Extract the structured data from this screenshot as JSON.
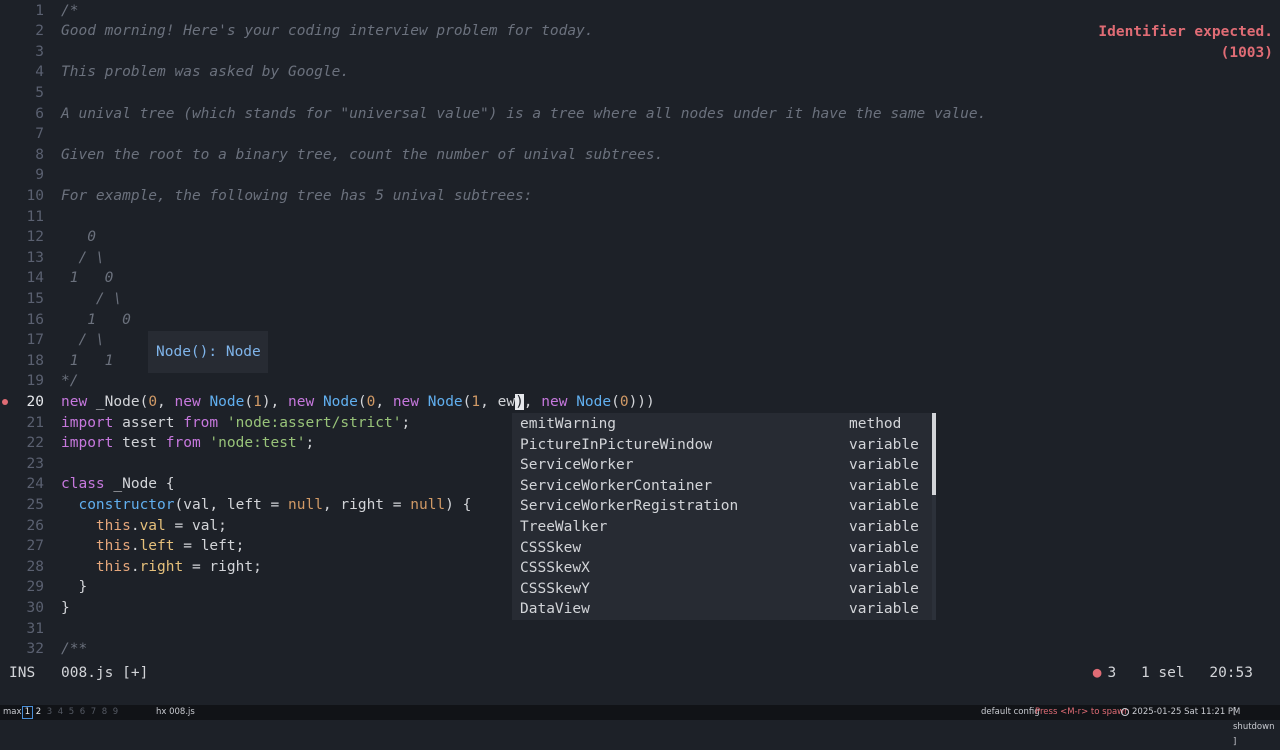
{
  "editor": {
    "lines": [
      {
        "n": "1",
        "parts": [
          {
            "t": "/*",
            "c": "comment"
          }
        ]
      },
      {
        "n": "2",
        "parts": [
          {
            "t": "Good morning! Here's your coding interview problem for today.",
            "c": "comment"
          }
        ]
      },
      {
        "n": "3",
        "parts": []
      },
      {
        "n": "4",
        "parts": [
          {
            "t": "This problem was asked by Google.",
            "c": "comment"
          }
        ]
      },
      {
        "n": "5",
        "parts": []
      },
      {
        "n": "6",
        "parts": [
          {
            "t": "A unival tree (which stands for \"universal value\") is a tree where all nodes under it have the same value.",
            "c": "comment"
          }
        ]
      },
      {
        "n": "7",
        "parts": []
      },
      {
        "n": "8",
        "parts": [
          {
            "t": "Given the root to a binary tree, count the number of unival subtrees.",
            "c": "comment"
          }
        ]
      },
      {
        "n": "9",
        "parts": []
      },
      {
        "n": "10",
        "parts": [
          {
            "t": "For example, the following tree has 5 unival subtrees:",
            "c": "comment"
          }
        ]
      },
      {
        "n": "11",
        "parts": []
      },
      {
        "n": "12",
        "parts": [
          {
            "t": "   0",
            "c": "comment"
          }
        ]
      },
      {
        "n": "13",
        "parts": [
          {
            "t": "  / \\",
            "c": "comment"
          }
        ]
      },
      {
        "n": "14",
        "parts": [
          {
            "t": " 1   0",
            "c": "comment"
          }
        ]
      },
      {
        "n": "15",
        "parts": [
          {
            "t": "    / \\",
            "c": "comment"
          }
        ]
      },
      {
        "n": "16",
        "parts": [
          {
            "t": "   1   0",
            "c": "comment"
          }
        ]
      },
      {
        "n": "17",
        "parts": [
          {
            "t": "  / \\",
            "c": "comment"
          }
        ]
      },
      {
        "n": "18",
        "parts": [
          {
            "t": " 1   1",
            "c": "comment"
          }
        ]
      },
      {
        "n": "19",
        "parts": [
          {
            "t": "*/",
            "c": "comment"
          }
        ]
      },
      {
        "n": "20",
        "current": true,
        "diag": true,
        "parts": [
          {
            "t": "new ",
            "c": "kw"
          },
          {
            "t": "_Node(",
            "c": "plain"
          },
          {
            "t": "0",
            "c": "num"
          },
          {
            "t": ", ",
            "c": "plain"
          },
          {
            "t": "new ",
            "c": "kw"
          },
          {
            "t": "Node",
            "c": "fn"
          },
          {
            "t": "(",
            "c": "plain"
          },
          {
            "t": "1",
            "c": "num"
          },
          {
            "t": "), ",
            "c": "plain"
          },
          {
            "t": "new ",
            "c": "kw"
          },
          {
            "t": "Node",
            "c": "fn"
          },
          {
            "t": "(",
            "c": "plain"
          },
          {
            "t": "0",
            "c": "num"
          },
          {
            "t": ", ",
            "c": "plain"
          },
          {
            "t": "new ",
            "c": "kw"
          },
          {
            "t": "Node",
            "c": "fn"
          },
          {
            "t": "(",
            "c": "plain"
          },
          {
            "t": "1",
            "c": "num"
          },
          {
            "t": ", ",
            "c": "plain"
          },
          {
            "t": "ew",
            "c": "plain"
          },
          {
            "t": ")",
            "c": "cursor"
          },
          {
            "t": ", ",
            "c": "plain"
          },
          {
            "t": "new ",
            "c": "kw"
          },
          {
            "t": "Node",
            "c": "fn"
          },
          {
            "t": "(",
            "c": "plain"
          },
          {
            "t": "0",
            "c": "num"
          },
          {
            "t": ")))",
            "c": "plain"
          }
        ]
      },
      {
        "n": "21",
        "parts": [
          {
            "t": "import ",
            "c": "kw"
          },
          {
            "t": "assert ",
            "c": "plain"
          },
          {
            "t": "from ",
            "c": "kw"
          },
          {
            "t": "'node:assert/strict'",
            "c": "str"
          },
          {
            "t": ";",
            "c": "plain"
          }
        ]
      },
      {
        "n": "22",
        "parts": [
          {
            "t": "import ",
            "c": "kw"
          },
          {
            "t": "test ",
            "c": "plain"
          },
          {
            "t": "from ",
            "c": "kw"
          },
          {
            "t": "'node:test'",
            "c": "str"
          },
          {
            "t": ";",
            "c": "plain"
          }
        ]
      },
      {
        "n": "23",
        "parts": []
      },
      {
        "n": "24",
        "parts": [
          {
            "t": "class ",
            "c": "kw"
          },
          {
            "t": "_Node {",
            "c": "plain"
          }
        ]
      },
      {
        "n": "25",
        "parts": [
          {
            "t": "  ",
            "c": "plain"
          },
          {
            "t": "constructor",
            "c": "fn"
          },
          {
            "t": "(val, left = ",
            "c": "plain"
          },
          {
            "t": "null",
            "c": "num"
          },
          {
            "t": ", right = ",
            "c": "plain"
          },
          {
            "t": "null",
            "c": "num"
          },
          {
            "t": ") {",
            "c": "plain"
          }
        ]
      },
      {
        "n": "26",
        "parts": [
          {
            "t": "    ",
            "c": "plain"
          },
          {
            "t": "this",
            "c": "this"
          },
          {
            "t": ".",
            "c": "plain"
          },
          {
            "t": "val",
            "c": "prop"
          },
          {
            "t": " = val;",
            "c": "plain"
          }
        ]
      },
      {
        "n": "27",
        "parts": [
          {
            "t": "    ",
            "c": "plain"
          },
          {
            "t": "this",
            "c": "this"
          },
          {
            "t": ".",
            "c": "plain"
          },
          {
            "t": "left",
            "c": "prop"
          },
          {
            "t": " = left;",
            "c": "plain"
          }
        ]
      },
      {
        "n": "28",
        "parts": [
          {
            "t": "    ",
            "c": "plain"
          },
          {
            "t": "this",
            "c": "this"
          },
          {
            "t": ".",
            "c": "plain"
          },
          {
            "t": "right",
            "c": "prop"
          },
          {
            "t": " = right;",
            "c": "plain"
          }
        ]
      },
      {
        "n": "29",
        "parts": [
          {
            "t": "  }",
            "c": "plain"
          }
        ]
      },
      {
        "n": "30",
        "parts": [
          {
            "t": "}",
            "c": "plain"
          }
        ]
      },
      {
        "n": "31",
        "parts": []
      },
      {
        "n": "32",
        "parts": [
          {
            "t": "/**",
            "c": "comment"
          }
        ]
      }
    ]
  },
  "diagnostic": {
    "line1": "Identifier expected.",
    "line2": "(1003)"
  },
  "hover": {
    "text": "Node(): Node"
  },
  "completion": {
    "items": [
      {
        "label": "emitWarning",
        "kind": "method"
      },
      {
        "label": "PictureInPictureWindow",
        "kind": "variable"
      },
      {
        "label": "ServiceWorker",
        "kind": "variable"
      },
      {
        "label": "ServiceWorkerContainer",
        "kind": "variable"
      },
      {
        "label": "ServiceWorkerRegistration",
        "kind": "variable"
      },
      {
        "label": "TreeWalker",
        "kind": "variable"
      },
      {
        "label": "CSSSkew",
        "kind": "variable"
      },
      {
        "label": "CSSSkewX",
        "kind": "variable"
      },
      {
        "label": "CSSSkewY",
        "kind": "variable"
      },
      {
        "label": "DataView",
        "kind": "variable"
      }
    ]
  },
  "statusline": {
    "mode": "INS",
    "file": "008.js [+]",
    "errors": "3",
    "selection": "1 sel",
    "position": "20:53"
  },
  "taskbar": {
    "layout": "max",
    "workspaces": [
      "1",
      "2",
      "3",
      "4",
      "5",
      "6",
      "7",
      "8",
      "9"
    ],
    "window": "hx 008.js",
    "config": "default config",
    "hint": "Press <M-r> to spawn",
    "datetime": "2025-01-25 Sat 11:21 PM",
    "shutdown": "[ shutdown ]"
  },
  "colors": {
    "error": "#e06c75",
    "background": "#1d2128",
    "accent": "#4a8fd8"
  }
}
